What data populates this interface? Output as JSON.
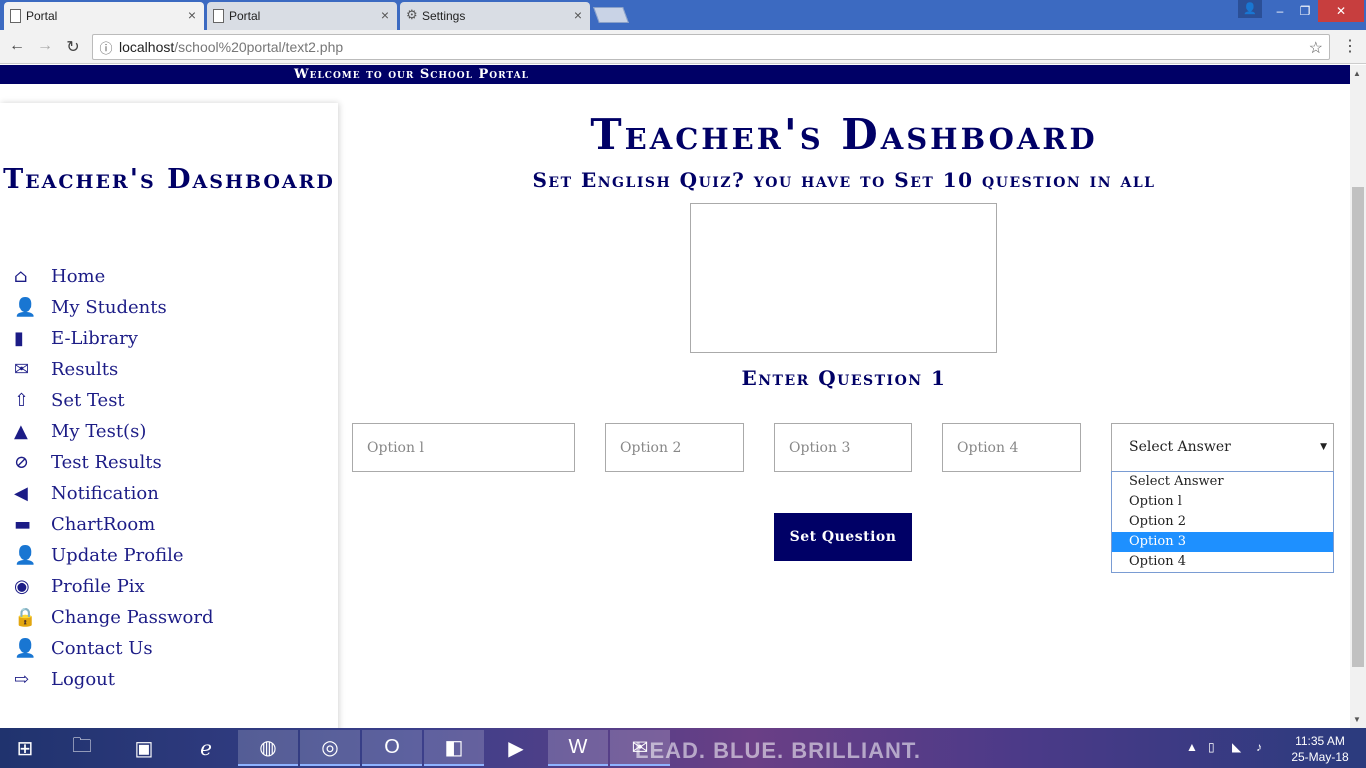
{
  "browser": {
    "tabs": [
      {
        "label": "Portal",
        "close": "×"
      },
      {
        "label": "Portal",
        "close": "×"
      },
      {
        "label": "Settings",
        "close": "×"
      }
    ],
    "url_host": "localhost",
    "url_path": "/school%20portal/text2.php",
    "window_controls": {
      "minimize": "‒",
      "restore": "❐",
      "close": "✕"
    }
  },
  "page": {
    "welcome": "Welcome to our School Portal",
    "sidebar": {
      "title": "Teacher's Dashboard",
      "items": [
        {
          "label": "Home",
          "icon": "home-icon"
        },
        {
          "label": "My Students",
          "icon": "user-icon"
        },
        {
          "label": "E-Library",
          "icon": "book-icon"
        },
        {
          "label": "Results",
          "icon": "envelope-icon"
        },
        {
          "label": "Set Test",
          "icon": "upload-icon"
        },
        {
          "label": "My Test(s)",
          "icon": "tree-icon"
        },
        {
          "label": "Test Results",
          "icon": "paperclip-icon"
        },
        {
          "label": "Notification",
          "icon": "bullhorn-icon"
        },
        {
          "label": "ChartRoom",
          "icon": "comment-icon"
        },
        {
          "label": "Update Profile",
          "icon": "user-icon"
        },
        {
          "label": "Profile Pix",
          "icon": "camera-icon"
        },
        {
          "label": "Change Password",
          "icon": "lock-icon"
        },
        {
          "label": "Contact Us",
          "icon": "user-icon"
        },
        {
          "label": "Logout",
          "icon": "logout-icon"
        }
      ]
    },
    "main": {
      "title": "Teacher's Dashboard",
      "subtitle": "Set English Quiz? you have to Set 10 question in all",
      "enter_question": "Enter Question 1",
      "question_value": "",
      "options": [
        {
          "placeholder": "Option l"
        },
        {
          "placeholder": "Option 2"
        },
        {
          "placeholder": "Option 3"
        },
        {
          "placeholder": "Option 4"
        }
      ],
      "answer_select": {
        "selected": "Select Answer",
        "options": [
          "Select Answer",
          "Option l",
          "Option 2",
          "Option 3",
          "Option 4"
        ],
        "highlighted": "Option 3"
      },
      "submit_label": "Set Question"
    }
  },
  "taskbar": {
    "watermark": "LEAD. BLUE. BRILLIANT.",
    "time": "11:35 AM",
    "date": "25-May-18"
  },
  "colors": {
    "navy": "#000066",
    "nav_text": "#1c1c86",
    "tab_bar": "#3c6ac1",
    "dropdown_highlight": "#1e90ff"
  }
}
